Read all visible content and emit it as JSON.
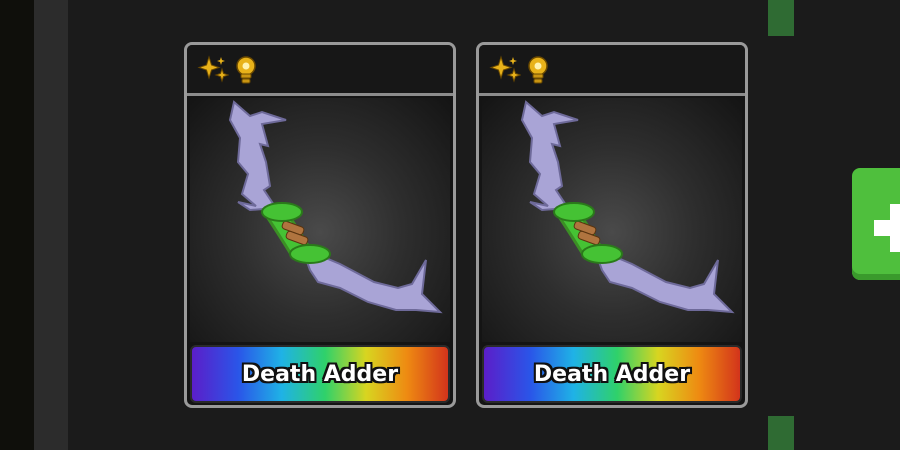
{
  "inventory": {
    "items": [
      {
        "name": "Death Adder",
        "badges": [
          "sparkles-icon",
          "lightbulb-icon"
        ],
        "rarity_colors": [
          "#5b1ec9",
          "#2a55e8",
          "#1fb2e6",
          "#2fd16a",
          "#d8d520",
          "#ee8a12",
          "#d3341b"
        ]
      },
      {
        "name": "Death Adder",
        "badges": [
          "sparkles-icon",
          "lightbulb-icon"
        ],
        "rarity_colors": [
          "#5b1ec9",
          "#2a55e8",
          "#1fb2e6",
          "#2fd16a",
          "#d8d520",
          "#ee8a12",
          "#d3341b"
        ]
      }
    ],
    "add_button_icon": "plus-icon"
  },
  "colors": {
    "badge_gold": "#e8b21a",
    "blade_lavender": "#a9a4d6",
    "grip_green": "#45c234",
    "add_button_green": "#4fbf3d"
  }
}
